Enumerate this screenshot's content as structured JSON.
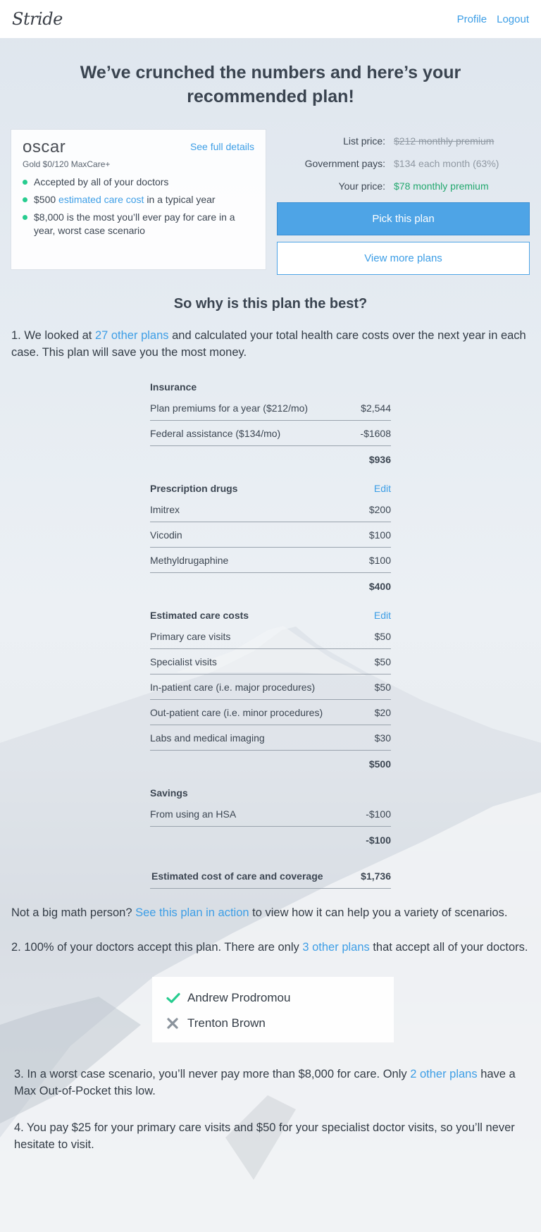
{
  "header": {
    "logo": "Stride",
    "nav": [
      "Profile",
      "Logout"
    ]
  },
  "headline": "We’ve crunched the numbers and here’s your recommended plan!",
  "plan": {
    "carrier": "oscar",
    "details_link": "See full details",
    "name": "Gold $0/120 MaxCare+",
    "bullets": {
      "b1": "Accepted by all of your doctors",
      "b2_pre": "$500 ",
      "b2_link": "estimated care cost",
      "b2_post": " in a typical year",
      "b3": "$8,000 is the most you’ll ever pay for care in a year, worst case scenario"
    }
  },
  "pricing": {
    "list_label": "List price:",
    "list_value": "$212 monthly premium",
    "gov_label": "Government pays:",
    "gov_value": "$134 each month (63%)",
    "your_label": "Your price:",
    "your_value": "$78 monthly premium",
    "pick_button": "Pick this plan",
    "more_button": "View more plans"
  },
  "why_title": "So why is this plan the best?",
  "reason1": {
    "pre": "1.  We looked at ",
    "link": "27 other plans",
    "post": " and calculated your total health care costs over the next year in each case. This plan will save you the most money."
  },
  "costs": {
    "edit_label": "Edit",
    "insurance": {
      "title": "Insurance",
      "rows": [
        {
          "label": "Plan premiums for a year ($212/mo)",
          "value": "$2,544"
        },
        {
          "label": "Federal assistance ($134/mo)",
          "value": "-$1608"
        }
      ],
      "subtotal": "$936"
    },
    "drugs": {
      "title": "Prescription drugs",
      "rows": [
        {
          "label": "Imitrex",
          "value": "$200"
        },
        {
          "label": "Vicodin",
          "value": "$100"
        },
        {
          "label": "Methyldrugaphine",
          "value": "$100"
        }
      ],
      "subtotal": "$400"
    },
    "care": {
      "title": "Estimated care costs",
      "rows": [
        {
          "label": "Primary care visits",
          "value": "$50"
        },
        {
          "label": "Specialist visits",
          "value": "$50"
        },
        {
          "label": "In-patient care (i.e. major procedures)",
          "value": "$50"
        },
        {
          "label": "Out-patient care (i.e. minor procedures)",
          "value": "$20"
        },
        {
          "label": "Labs and medical imaging",
          "value": "$30"
        }
      ],
      "subtotal": "$500"
    },
    "savings": {
      "title": "Savings",
      "rows": [
        {
          "label": "From using an HSA",
          "value": "-$100"
        }
      ],
      "subtotal": "-$100"
    },
    "total_label": "Estimated cost of care and coverage",
    "total_value": "$1,736"
  },
  "math": {
    "pre": "Not a big math person? ",
    "link": "See this plan in action",
    "post": " to view how it can help you a variety of scenarios."
  },
  "reason2": {
    "pre": "2. 100% of your doctors accept this plan. There are only ",
    "link": "3 other plans",
    "post": " that accept all of your doctors."
  },
  "doctors": [
    {
      "name": "Andrew Prodromou",
      "status": "check-icon",
      "color": "#27cc8f"
    },
    {
      "name": "Trenton Brown",
      "status": "x-icon",
      "color": "#8a939c"
    }
  ],
  "reason3": {
    "pre": "3. In a worst case scenario, you’ll never pay more than $8,000 for care. Only ",
    "link": "2 other plans",
    "post": " have a Max Out-of-Pocket this low."
  },
  "reason4": "4. You pay $25 for your primary care visits and $50 for your specialist doctor visits, so you’ll never hesitate to visit.",
  "colors": {
    "accent": "#3d9ee6",
    "button": "#4ea4e6",
    "success": "#27cc8f",
    "price_green": "#22a86e"
  }
}
